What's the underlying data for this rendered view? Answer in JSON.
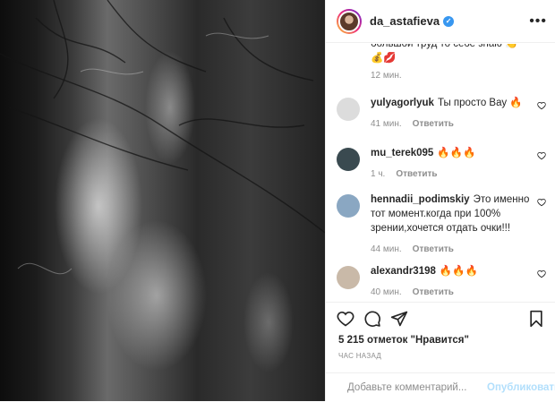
{
  "post": {
    "author": "da_astafieva",
    "verified": true,
    "likes_text": "5 215 отметок \"Нравится\"",
    "time_ago": "час назад"
  },
  "partial_comment": {
    "text": "большой труд то себе знаю 👏",
    "emojis": "💰💋",
    "time": "12 мин."
  },
  "comments": [
    {
      "user": "yulyagorlyuk",
      "text": "Ты просто Вау 🔥",
      "time": "41 мин.",
      "reply": "Ответить",
      "avatar_color": "#dcdcdc"
    },
    {
      "user": "mu_terek095",
      "text": "🔥🔥🔥",
      "time": "1 ч.",
      "reply": "Ответить",
      "avatar_color": "#3a4a50"
    },
    {
      "user": "hennadii_podimskiy",
      "text": "Это именно тот момент.когда при 100% зрении,хочется отдать очки!!!",
      "time": "44 мин.",
      "reply": "Ответить",
      "avatar_color": "#8aa7c2"
    },
    {
      "user": "alexandr3198",
      "text": "🔥🔥🔥",
      "time": "40 мин.",
      "reply": "Ответить",
      "avatar_color": "#c9b9a8"
    }
  ],
  "add_comment": {
    "placeholder": "Добавьте комментарий...",
    "publish_label": "Опубликовать"
  },
  "icons": {
    "like": "heart-icon",
    "comment": "comment-icon",
    "share": "share-icon",
    "save": "bookmark-icon",
    "emoji": "emoji-icon",
    "more": "more-icon"
  },
  "colors": {
    "verified": "#3897f0",
    "publish_disabled": "#b2dffc",
    "muted_text": "#8e8e8e"
  }
}
